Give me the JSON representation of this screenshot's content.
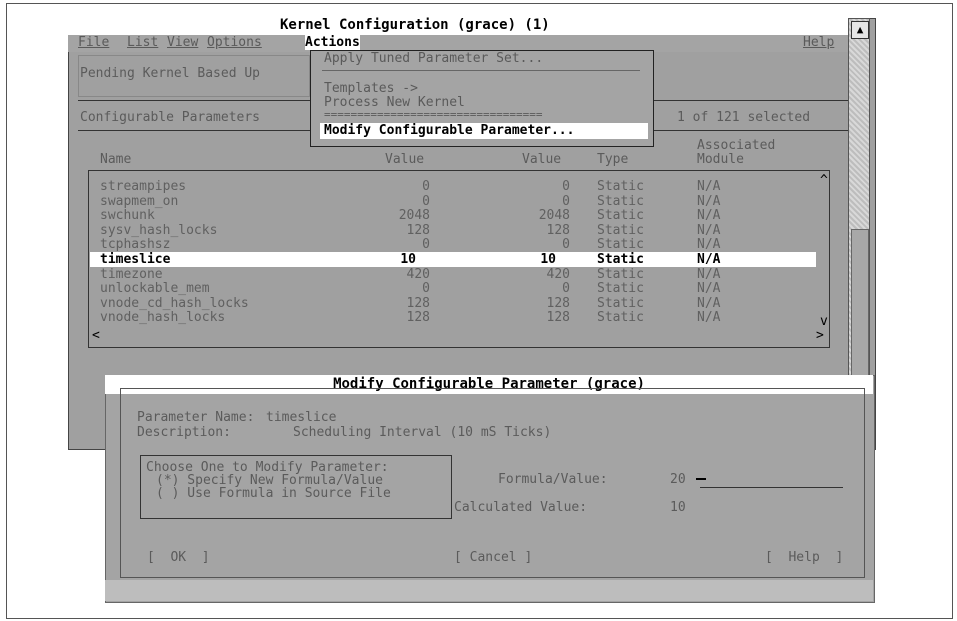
{
  "window": {
    "title": "Kernel Configuration (grace) (1)",
    "menus": [
      "File",
      "List",
      "View",
      "Options",
      "Actions",
      "Help"
    ],
    "active_menu": "Actions"
  },
  "panel": {
    "pending_label": "Pending Kernel Based Up",
    "configurable_label": "Configurable Parameters",
    "selected_count": "1 of 121 selected"
  },
  "actions_menu": {
    "items": [
      "Apply Tuned Parameter Set...",
      "Templates ->",
      "Process New Kernel",
      "=================================",
      "Modify Configurable Parameter..."
    ]
  },
  "table": {
    "headers": {
      "name": "Name",
      "value1": "Value",
      "value2": "Value",
      "type": "Type",
      "module_line1": "Associated",
      "module_line2": "Module"
    },
    "rows": [
      {
        "name": "streampipes",
        "value": "0",
        "pending": "0",
        "type": "Static",
        "module": "N/A"
      },
      {
        "name": "swapmem_on",
        "value": "0",
        "pending": "0",
        "type": "Static",
        "module": "N/A"
      },
      {
        "name": "swchunk",
        "value": "2048",
        "pending": "2048",
        "type": "Static",
        "module": "N/A"
      },
      {
        "name": "sysv_hash_locks",
        "value": "128",
        "pending": "128",
        "type": "Static",
        "module": "N/A"
      },
      {
        "name": "tcphashsz",
        "value": "0",
        "pending": "0",
        "type": "Static",
        "module": "N/A"
      },
      {
        "name": "timeslice",
        "value": "10",
        "pending": "10",
        "type": "Static",
        "module": "N/A"
      },
      {
        "name": "timezone",
        "value": "420",
        "pending": "420",
        "type": "Static",
        "module": "N/A"
      },
      {
        "name": "unlockable_mem",
        "value": "0",
        "pending": "0",
        "type": "Static",
        "module": "N/A"
      },
      {
        "name": "vnode_cd_hash_locks",
        "value": "128",
        "pending": "128",
        "type": "Static",
        "module": "N/A"
      },
      {
        "name": "vnode_hash_locks",
        "value": "128",
        "pending": "128",
        "type": "Static",
        "module": "N/A"
      }
    ],
    "selected_index": 5
  },
  "dialog": {
    "title": "Modify Configurable Parameter (grace)",
    "param_name_label": "Parameter Name:",
    "param_name": "timeslice",
    "description_label": "Description:",
    "description": "Scheduling Interval (10 mS Ticks)",
    "choose_label": "Choose One to Modify Parameter:",
    "option1": "(*) Specify New Formula/Value",
    "option2": "( ) Use Formula in Source File",
    "formula_label": "Formula/Value:",
    "formula_value": "20",
    "calculated_label": "Calculated Value:",
    "calculated_value": "10",
    "ok": "[  OK  ]",
    "cancel": "[ Cancel ]",
    "help": "[  Help  ]"
  }
}
